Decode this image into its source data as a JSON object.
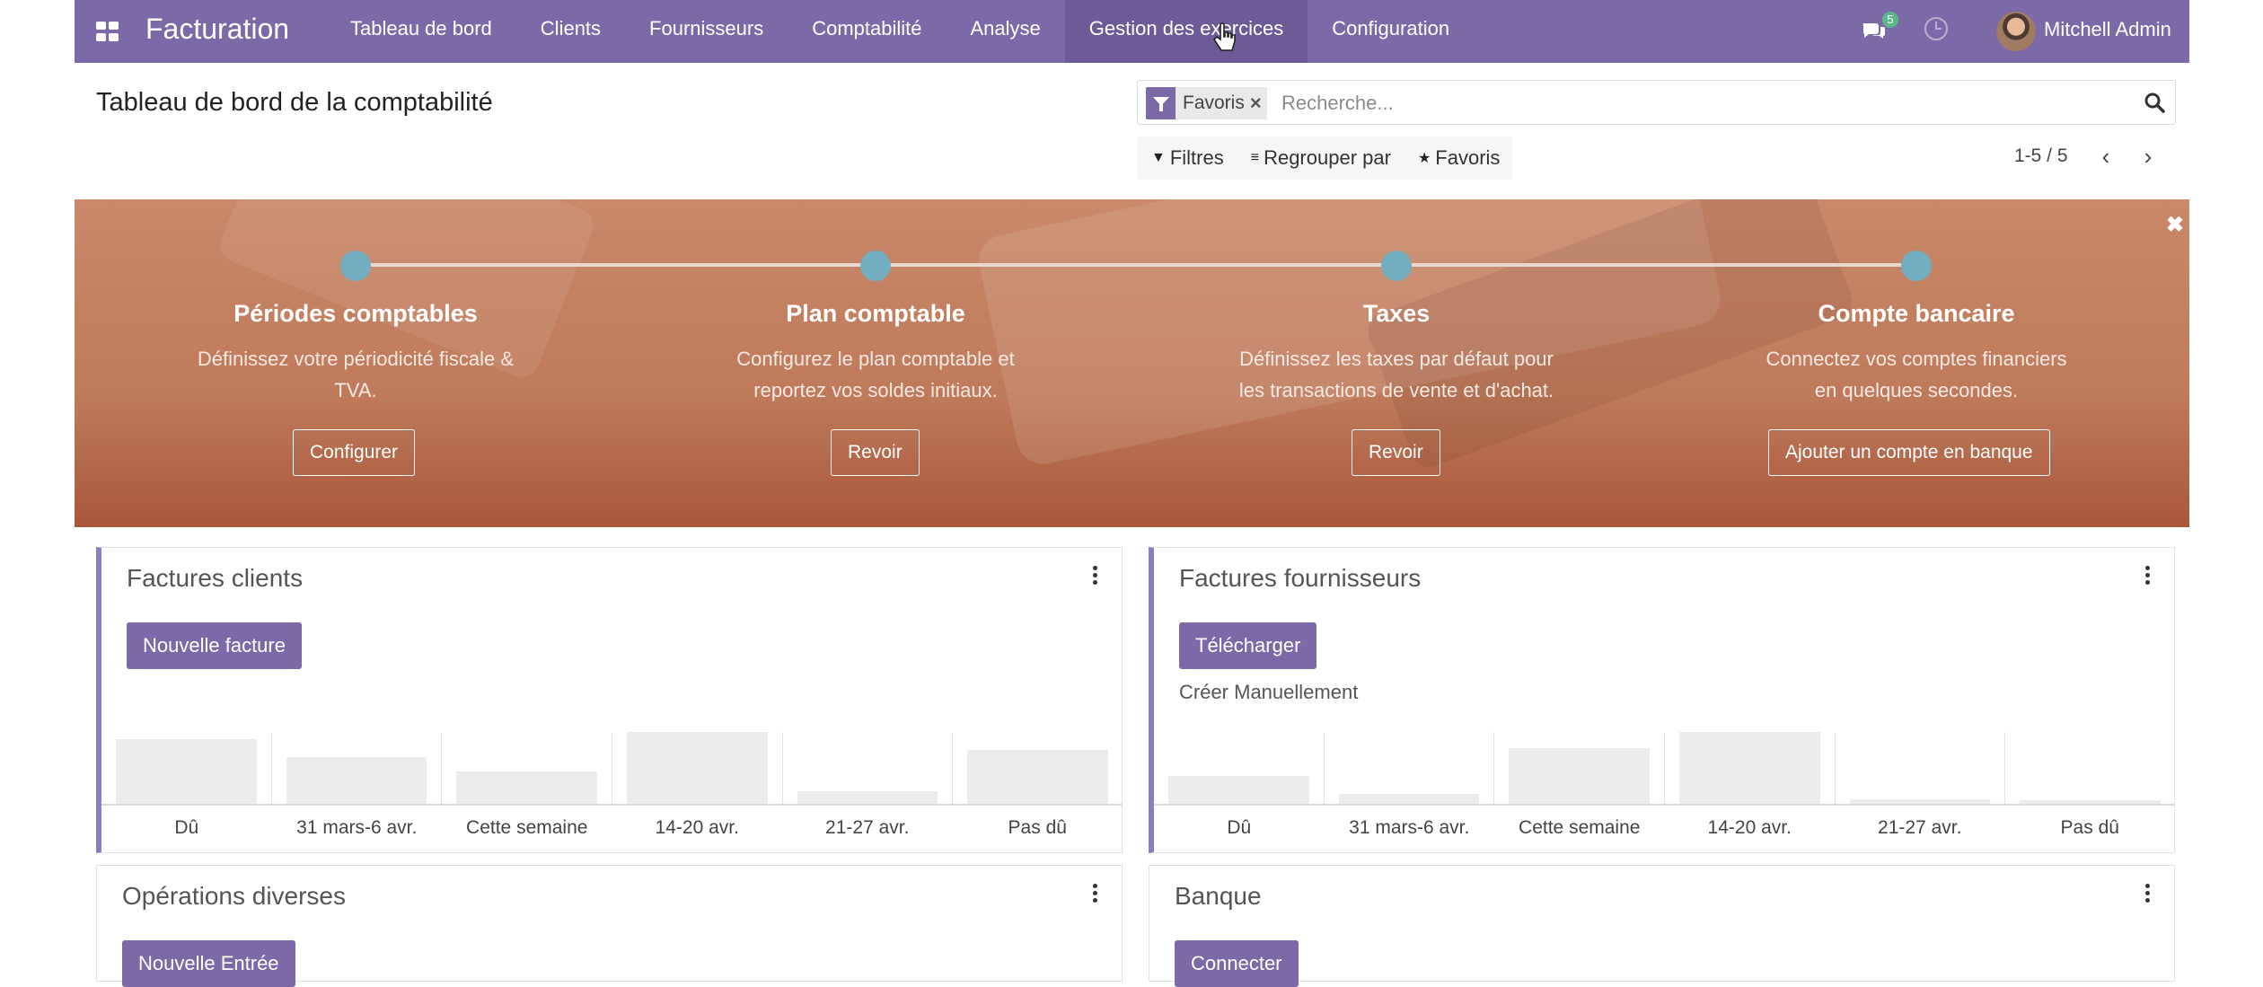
{
  "navbar": {
    "brand": "Facturation",
    "menu": [
      "Tableau de bord",
      "Clients",
      "Fournisseurs",
      "Comptabilité",
      "Analyse",
      "Gestion des exercices",
      "Configuration"
    ],
    "active_menu": "Gestion des exercices",
    "chat_badge": "5",
    "user_name": "Mitchell Admin",
    "icons": [
      "apps-icon",
      "chat-icon",
      "clock-icon",
      "avatar"
    ]
  },
  "control_panel": {
    "title": "Tableau de bord de la comptabilité",
    "facet_label": "Favoris",
    "search_placeholder": "Recherche...",
    "filters_label": "Filtres",
    "groupby_label": "Regrouper par",
    "favorites_label": "Favoris",
    "pager": "1-5 / 5"
  },
  "onboarding": {
    "steps": [
      {
        "title": "Périodes comptables",
        "desc_line1": "Définissez votre périodicité fiscale &",
        "desc_line2": "TVA.",
        "button": "Configurer"
      },
      {
        "title": "Plan comptable",
        "desc_line1": "Configurez le plan comptable et",
        "desc_line2": "reportez vos soldes initiaux.",
        "button": "Revoir"
      },
      {
        "title": "Taxes",
        "desc_line1": "Définissez les taxes par défaut pour",
        "desc_line2": "les transactions de vente et d'achat.",
        "button": "Revoir"
      },
      {
        "title": "Compte bancaire",
        "desc_line1": "Connectez vos comptes financiers",
        "desc_line2": "en quelques secondes.",
        "button": "Ajouter un compte en banque"
      }
    ],
    "colors": {
      "banner": "#bf7a5b",
      "step_dot": "#72aebf"
    }
  },
  "cards": [
    {
      "title": "Factures clients",
      "button": "Nouvelle facture",
      "link": ""
    },
    {
      "title": "Factures fournisseurs",
      "button": "Télécharger",
      "link": "Créer Manuellement"
    },
    {
      "title": "Opérations diverses",
      "button": "Nouvelle Entrée",
      "link": ""
    },
    {
      "title": "Banque",
      "button": "Connecter",
      "link": ""
    }
  ],
  "chart_data": [
    {
      "type": "bar",
      "categories": [
        "Dû",
        "31 mars-6 avr.",
        "Cette semaine",
        "14-20 avr.",
        "21-27 avr.",
        "Pas dû"
      ],
      "values": [
        0.9,
        0.65,
        0.45,
        1.0,
        0.18,
        0.75
      ],
      "title": "",
      "xlabel": "",
      "ylabel": ""
    },
    {
      "type": "bar",
      "categories": [
        "Dû",
        "31 mars-6 avr.",
        "Cette semaine",
        "14-20 avr.",
        "21-27 avr.",
        "Pas dû"
      ],
      "values": [
        0.35,
        0.12,
        0.7,
        0.9,
        0.06,
        0.05
      ],
      "title": "",
      "xlabel": "",
      "ylabel": ""
    }
  ],
  "theme": {
    "primary": "#7c6aa8",
    "primary_dark": "#6d5b97",
    "accent_border": "#8e7cc3"
  }
}
